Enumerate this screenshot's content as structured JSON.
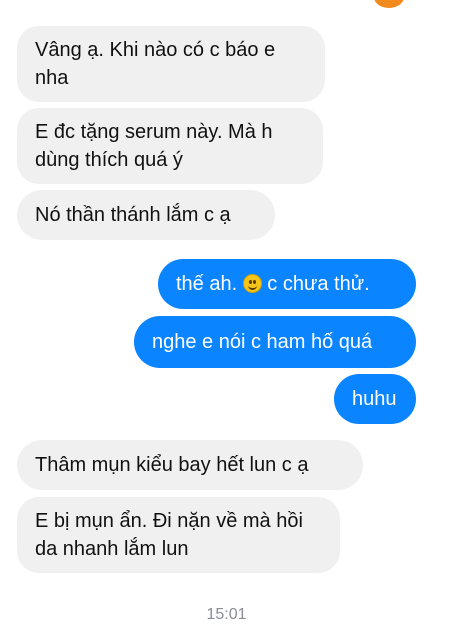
{
  "conversation": {
    "messages": [
      {
        "direction": "incoming",
        "text": "Vâng ạ. Khi nào có c báo e nha",
        "lines": [
          "Vâng ạ. Khi nào có c báo e",
          "nha"
        ]
      },
      {
        "direction": "incoming",
        "text": "E đc tặng serum này. Mà h dùng thích quá ý",
        "lines": [
          "E đc tặng serum này. Mà h",
          "dùng thích quá ý"
        ]
      },
      {
        "direction": "incoming",
        "text": "Nó thần thánh lắm c ạ",
        "lines": [
          "Nó thần thánh lắm c ạ"
        ]
      },
      {
        "direction": "outgoing",
        "text_before": "thế ah.",
        "emoji": "smiling-face-emoji",
        "text_after": "c chưa thử."
      },
      {
        "direction": "outgoing",
        "text": "nghe e nói c ham hố quá",
        "lines": [
          "nghe e nói c ham hố quá"
        ]
      },
      {
        "direction": "outgoing",
        "text": "huhu",
        "lines": [
          "huhu"
        ]
      },
      {
        "direction": "incoming",
        "text": "Thâm mụn kiểu bay hết lun c ạ",
        "lines": [
          "Thâm mụn kiểu bay hết lun c ạ"
        ]
      },
      {
        "direction": "incoming",
        "text": "E bị mụn ẩn. Đi nặn về mà hồi da nhanh lắm lun",
        "lines": [
          "E bị mụn ẩn. Đi nặn về mà hồi",
          "da nhanh lắm lun"
        ]
      }
    ],
    "timestamp": "15:01"
  },
  "colors": {
    "incoming_bubble": "#f1f0f0",
    "outgoing_bubble": "#0a84ff",
    "incoming_text": "#111111",
    "outgoing_text": "#ffffff",
    "timestamp_text": "#8a8d91",
    "avatar": "#f28a1e"
  }
}
